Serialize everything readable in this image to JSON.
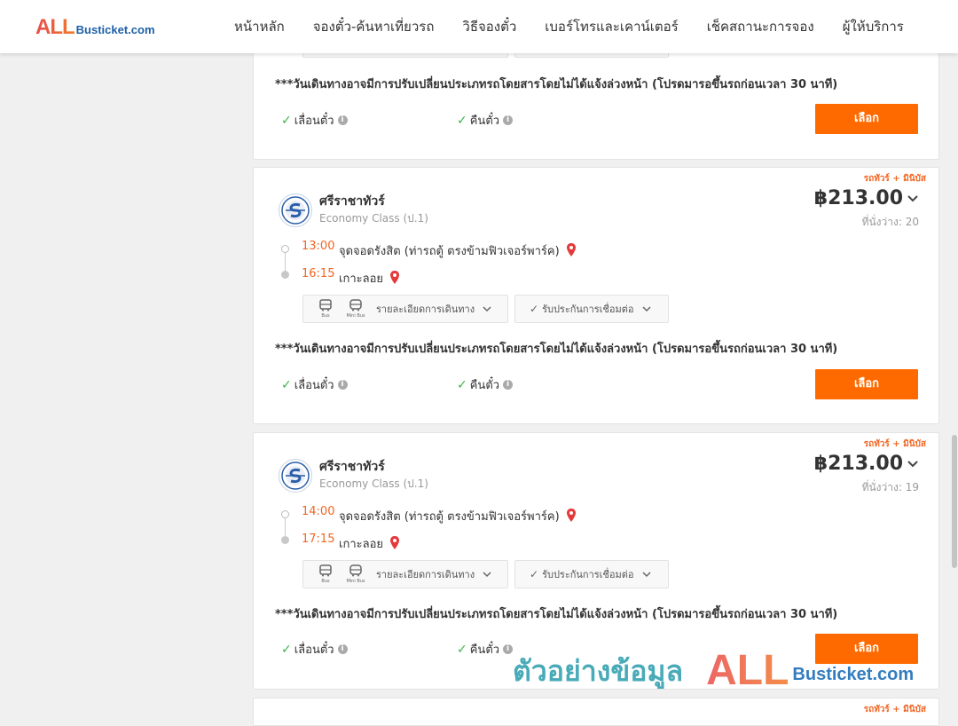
{
  "brand": {
    "all": "ALL",
    "busticket": "Busticket.com"
  },
  "nav": [
    "หน้าหลัก",
    "จองตั๋ว-ค้นหาเที่ยวรถ",
    "วิธีจองตั๋ว",
    "เบอร์โทรและเคาน์เตอร์",
    "เช็คสถานะการจอง",
    "ผู้ให้บริการ"
  ],
  "common": {
    "notice": "***วันเดินทางอาจมีการปรับเปลี่ยนประเภทรถโดยสารโดยไม่ได้แจ้งล่วงหน้า (โปรดมารอขึ้นรถก่อนเวลา 30 นาที)",
    "change_label": "เลื่อนตั๋ว",
    "refund_label": "คืนตั๋ว",
    "select_label": "เลือก",
    "details_label": "รายละเอียดการเดินทาง",
    "insurance_label": "รับประกันการเชื่อมต่อ",
    "bus_icon_label": "Bus",
    "minibus_icon_label": "Mini Bus",
    "tag": "รถทัวร์ + มินิบัส",
    "info_glyph": "i",
    "check_glyph": "✓"
  },
  "trips": [
    {
      "operator": "ศรีราชาทัวร์",
      "class": "Economy Class (ป.1)",
      "price": "฿213.00",
      "seats": "ที่นั่งว่าง: 20",
      "depart_time": "13:00",
      "depart_place": "จุดจอดรังสิต (ท่ารถตู้ ตรงข้ามฟิวเจอร์พาร์ค)",
      "arrive_time": "16:15",
      "arrive_place": "เกาะลอย"
    },
    {
      "operator": "ศรีราชาทัวร์",
      "class": "Economy Class (ป.1)",
      "price": "฿213.00",
      "seats": "ที่นั่งว่าง: 19",
      "depart_time": "14:00",
      "depart_place": "จุดจอดรังสิต (ท่ารถตู้ ตรงข้ามฟิวเจอร์พาร์ค)",
      "arrive_time": "17:15",
      "arrive_place": "เกาะลอย"
    }
  ],
  "watermark": {
    "thai": "ตัวอย่างข้อมูล",
    "all": "ALL",
    "busticket": "Busticket.com"
  },
  "colors": {
    "accent": "#ff6a00",
    "time": "#f26522",
    "pin": "#e5393b",
    "check": "#3bb54a"
  }
}
